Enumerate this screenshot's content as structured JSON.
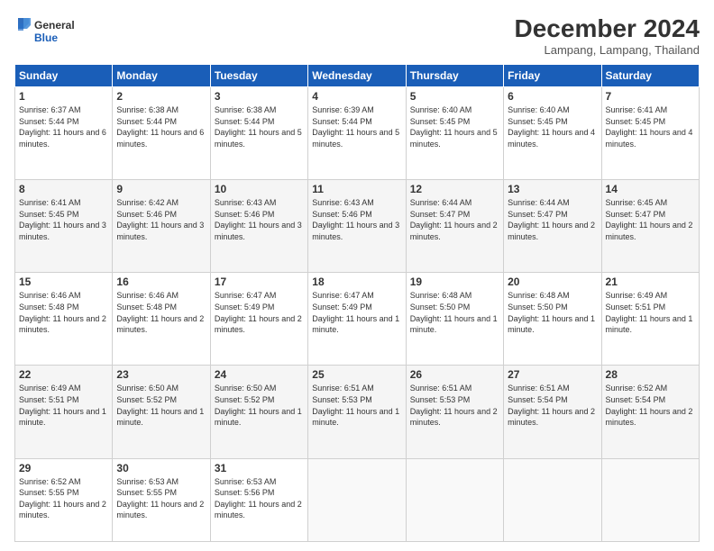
{
  "logo": {
    "text_general": "General",
    "text_blue": "Blue"
  },
  "header": {
    "month_title": "December 2024",
    "location": "Lampang, Lampang, Thailand"
  },
  "weekdays": [
    "Sunday",
    "Monday",
    "Tuesday",
    "Wednesday",
    "Thursday",
    "Friday",
    "Saturday"
  ],
  "weeks": [
    [
      {
        "day": "1",
        "sunrise": "Sunrise: 6:37 AM",
        "sunset": "Sunset: 5:44 PM",
        "daylight": "Daylight: 11 hours and 6 minutes."
      },
      {
        "day": "2",
        "sunrise": "Sunrise: 6:38 AM",
        "sunset": "Sunset: 5:44 PM",
        "daylight": "Daylight: 11 hours and 6 minutes."
      },
      {
        "day": "3",
        "sunrise": "Sunrise: 6:38 AM",
        "sunset": "Sunset: 5:44 PM",
        "daylight": "Daylight: 11 hours and 5 minutes."
      },
      {
        "day": "4",
        "sunrise": "Sunrise: 6:39 AM",
        "sunset": "Sunset: 5:44 PM",
        "daylight": "Daylight: 11 hours and 5 minutes."
      },
      {
        "day": "5",
        "sunrise": "Sunrise: 6:40 AM",
        "sunset": "Sunset: 5:45 PM",
        "daylight": "Daylight: 11 hours and 5 minutes."
      },
      {
        "day": "6",
        "sunrise": "Sunrise: 6:40 AM",
        "sunset": "Sunset: 5:45 PM",
        "daylight": "Daylight: 11 hours and 4 minutes."
      },
      {
        "day": "7",
        "sunrise": "Sunrise: 6:41 AM",
        "sunset": "Sunset: 5:45 PM",
        "daylight": "Daylight: 11 hours and 4 minutes."
      }
    ],
    [
      {
        "day": "8",
        "sunrise": "Sunrise: 6:41 AM",
        "sunset": "Sunset: 5:45 PM",
        "daylight": "Daylight: 11 hours and 3 minutes."
      },
      {
        "day": "9",
        "sunrise": "Sunrise: 6:42 AM",
        "sunset": "Sunset: 5:46 PM",
        "daylight": "Daylight: 11 hours and 3 minutes."
      },
      {
        "day": "10",
        "sunrise": "Sunrise: 6:43 AM",
        "sunset": "Sunset: 5:46 PM",
        "daylight": "Daylight: 11 hours and 3 minutes."
      },
      {
        "day": "11",
        "sunrise": "Sunrise: 6:43 AM",
        "sunset": "Sunset: 5:46 PM",
        "daylight": "Daylight: 11 hours and 3 minutes."
      },
      {
        "day": "12",
        "sunrise": "Sunrise: 6:44 AM",
        "sunset": "Sunset: 5:47 PM",
        "daylight": "Daylight: 11 hours and 2 minutes."
      },
      {
        "day": "13",
        "sunrise": "Sunrise: 6:44 AM",
        "sunset": "Sunset: 5:47 PM",
        "daylight": "Daylight: 11 hours and 2 minutes."
      },
      {
        "day": "14",
        "sunrise": "Sunrise: 6:45 AM",
        "sunset": "Sunset: 5:47 PM",
        "daylight": "Daylight: 11 hours and 2 minutes."
      }
    ],
    [
      {
        "day": "15",
        "sunrise": "Sunrise: 6:46 AM",
        "sunset": "Sunset: 5:48 PM",
        "daylight": "Daylight: 11 hours and 2 minutes."
      },
      {
        "day": "16",
        "sunrise": "Sunrise: 6:46 AM",
        "sunset": "Sunset: 5:48 PM",
        "daylight": "Daylight: 11 hours and 2 minutes."
      },
      {
        "day": "17",
        "sunrise": "Sunrise: 6:47 AM",
        "sunset": "Sunset: 5:49 PM",
        "daylight": "Daylight: 11 hours and 2 minutes."
      },
      {
        "day": "18",
        "sunrise": "Sunrise: 6:47 AM",
        "sunset": "Sunset: 5:49 PM",
        "daylight": "Daylight: 11 hours and 1 minute."
      },
      {
        "day": "19",
        "sunrise": "Sunrise: 6:48 AM",
        "sunset": "Sunset: 5:50 PM",
        "daylight": "Daylight: 11 hours and 1 minute."
      },
      {
        "day": "20",
        "sunrise": "Sunrise: 6:48 AM",
        "sunset": "Sunset: 5:50 PM",
        "daylight": "Daylight: 11 hours and 1 minute."
      },
      {
        "day": "21",
        "sunrise": "Sunrise: 6:49 AM",
        "sunset": "Sunset: 5:51 PM",
        "daylight": "Daylight: 11 hours and 1 minute."
      }
    ],
    [
      {
        "day": "22",
        "sunrise": "Sunrise: 6:49 AM",
        "sunset": "Sunset: 5:51 PM",
        "daylight": "Daylight: 11 hours and 1 minute."
      },
      {
        "day": "23",
        "sunrise": "Sunrise: 6:50 AM",
        "sunset": "Sunset: 5:52 PM",
        "daylight": "Daylight: 11 hours and 1 minute."
      },
      {
        "day": "24",
        "sunrise": "Sunrise: 6:50 AM",
        "sunset": "Sunset: 5:52 PM",
        "daylight": "Daylight: 11 hours and 1 minute."
      },
      {
        "day": "25",
        "sunrise": "Sunrise: 6:51 AM",
        "sunset": "Sunset: 5:53 PM",
        "daylight": "Daylight: 11 hours and 1 minute."
      },
      {
        "day": "26",
        "sunrise": "Sunrise: 6:51 AM",
        "sunset": "Sunset: 5:53 PM",
        "daylight": "Daylight: 11 hours and 2 minutes."
      },
      {
        "day": "27",
        "sunrise": "Sunrise: 6:51 AM",
        "sunset": "Sunset: 5:54 PM",
        "daylight": "Daylight: 11 hours and 2 minutes."
      },
      {
        "day": "28",
        "sunrise": "Sunrise: 6:52 AM",
        "sunset": "Sunset: 5:54 PM",
        "daylight": "Daylight: 11 hours and 2 minutes."
      }
    ],
    [
      {
        "day": "29",
        "sunrise": "Sunrise: 6:52 AM",
        "sunset": "Sunset: 5:55 PM",
        "daylight": "Daylight: 11 hours and 2 minutes."
      },
      {
        "day": "30",
        "sunrise": "Sunrise: 6:53 AM",
        "sunset": "Sunset: 5:55 PM",
        "daylight": "Daylight: 11 hours and 2 minutes."
      },
      {
        "day": "31",
        "sunrise": "Sunrise: 6:53 AM",
        "sunset": "Sunset: 5:56 PM",
        "daylight": "Daylight: 11 hours and 2 minutes."
      },
      null,
      null,
      null,
      null
    ]
  ]
}
